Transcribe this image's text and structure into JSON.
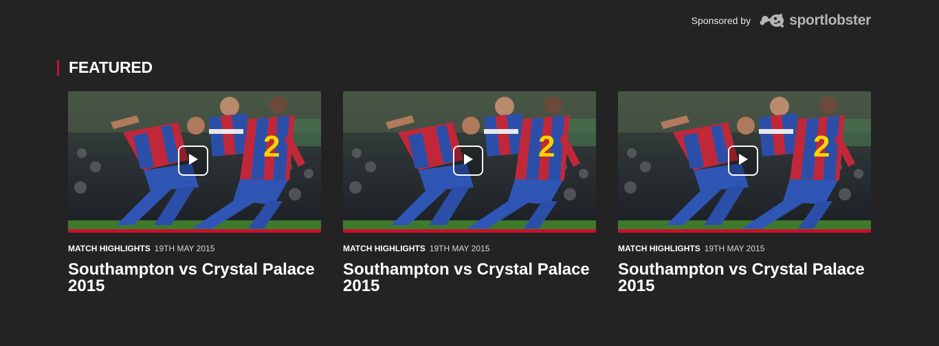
{
  "sponsor": {
    "label": "Sponsored by",
    "name": "sportlobster",
    "icon": "lobster-icon"
  },
  "section": {
    "title": "FEATURED",
    "accent_color": "#c8102e"
  },
  "cards": [
    {
      "category": "MATCH HIGHLIGHTS",
      "date": "19TH MAY 2015",
      "title": "Southampton vs Crystal Palace 2015",
      "icon": "play-icon"
    },
    {
      "category": "MATCH HIGHLIGHTS",
      "date": "19TH MAY 2015",
      "title": "Southampton vs Crystal Palace 2015",
      "icon": "play-icon"
    },
    {
      "category": "MATCH HIGHLIGHTS",
      "date": "19TH MAY 2015",
      "title": "Southampton vs Crystal Palace 2015",
      "icon": "play-icon"
    }
  ]
}
